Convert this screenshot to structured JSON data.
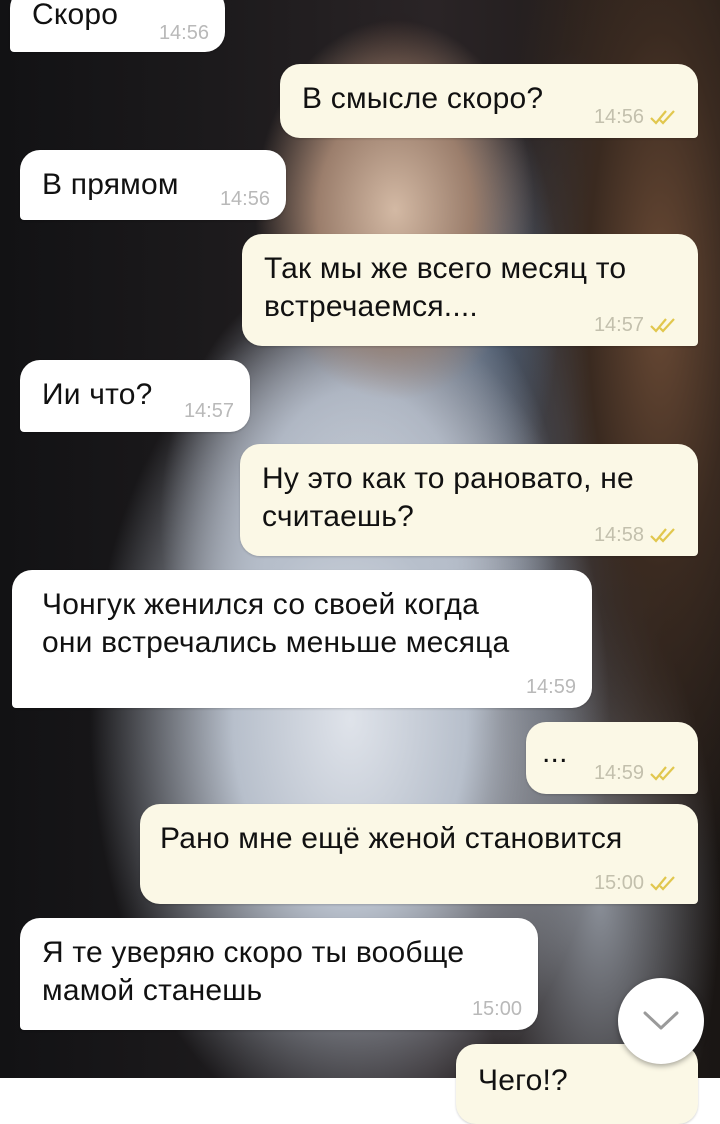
{
  "chat": {
    "messages": [
      {
        "text": "Скоро",
        "time": "14:56",
        "read_icon": ""
      },
      {
        "text": "В смысле скоро?",
        "time": "14:56",
        "read_icon": "double-check-icon"
      },
      {
        "text": "В прямом",
        "time": "14:56",
        "read_icon": ""
      },
      {
        "text": "Так мы же всего месяц то\nвстречаемся....",
        "time": "14:57",
        "read_icon": "double-check-icon"
      },
      {
        "text": "Ии что?",
        "time": "14:57",
        "read_icon": ""
      },
      {
        "text": "Ну это как то рановато, не\nсчитаешь?",
        "time": "14:58",
        "read_icon": "double-check-icon"
      },
      {
        "text": "Чонгук женился со своей когда\nони встречались меньше месяца",
        "time": "14:59",
        "read_icon": ""
      },
      {
        "text": "...",
        "time": "14:59",
        "read_icon": "double-check-icon"
      },
      {
        "text": "Рано мне ещё женой становится",
        "time": "15:00",
        "read_icon": "double-check-icon"
      },
      {
        "text": "Я те уверяю скоро ты вообще\nмамой станешь",
        "time": "15:00",
        "read_icon": ""
      },
      {
        "text": "Чего!?",
        "time": "",
        "read_icon": ""
      }
    ]
  },
  "scroll_button": {
    "icon": "chevron-down-icon"
  },
  "colors": {
    "incoming_bubble": "#ffffff",
    "outgoing_bubble": "#fbf8e6",
    "read_check": "#e1c74e",
    "timestamp": "#b9b9b9"
  }
}
